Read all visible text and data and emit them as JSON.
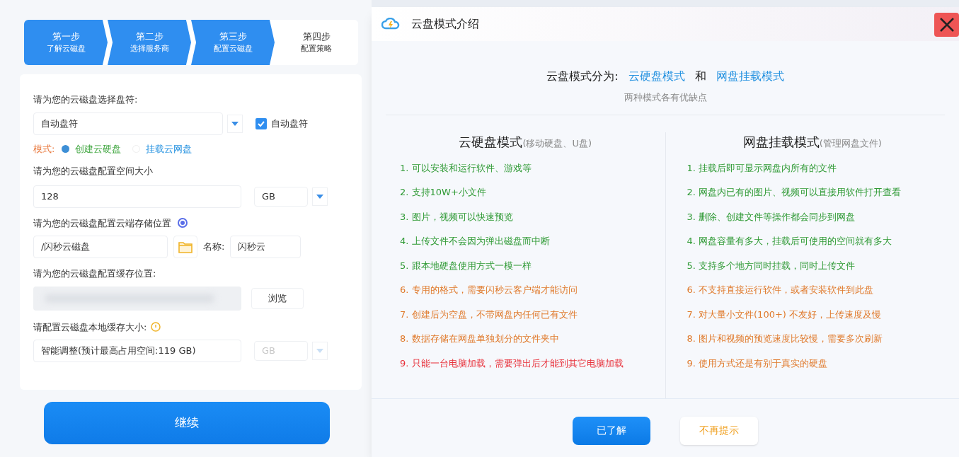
{
  "steps": [
    {
      "title": "第一步",
      "sub": "了解云磁盘",
      "completed": true
    },
    {
      "title": "第二步",
      "sub": "选择服务商",
      "completed": true
    },
    {
      "title": "第三步",
      "sub": "配置云磁盘",
      "completed": true
    },
    {
      "title": "第四步",
      "sub": "配置策略",
      "completed": false
    }
  ],
  "form": {
    "drive_letter": {
      "label": "请为您的云磁盘选择盘符:",
      "value": "自动盘符",
      "checkbox": {
        "label": "自动盘符",
        "checked": true
      }
    },
    "mode": {
      "label": "模式:",
      "options": [
        {
          "label": "创建云硬盘",
          "selected": true
        },
        {
          "label": "挂载云网盘",
          "selected": false
        }
      ]
    },
    "size": {
      "label": "请为您的云磁盘配置空间大小",
      "value": "128",
      "unit": "GB",
      "disabled": false
    },
    "cloud_location": {
      "label": "请为您的云磁盘配置云端存储位置",
      "value": "/闪秒云磁盘",
      "name_label": "名称:",
      "name_value": "闪秒云"
    },
    "cache_location": {
      "label": "请为您的云磁盘配置缓存位置:",
      "browse": "浏览"
    },
    "cache_size": {
      "label": "请配置云磁盘本地缓存大小:",
      "value": "智能调整(预计最高占用空间:119 GB)",
      "unit": "GB",
      "disabled": true
    },
    "continue": "继续"
  },
  "dialog": {
    "title": "云盘模式介绍",
    "intro": {
      "prefix": "云盘模式分为:",
      "mode_a": "云硬盘模式",
      "conj": "和",
      "mode_b": "网盘挂载模式",
      "subtitle": "两种模式各有优缺点"
    },
    "columns": [
      {
        "title": "云硬盘模式",
        "note": "(移动硬盘、U盘)",
        "items": [
          {
            "text": "1. 可以安装和运行软件、游戏等",
            "color": "#2f9a35"
          },
          {
            "text": "2. 支持10W+小文件",
            "color": "#2f9a35"
          },
          {
            "text": "3. 图片，视频可以快速预览",
            "color": "#2f9a35"
          },
          {
            "text": "4. 上传文件不会因为弹出磁盘而中断",
            "color": "#2f9a35"
          },
          {
            "text": "5. 跟本地硬盘使用方式一模一样",
            "color": "#2f9a35"
          },
          {
            "text": "6. 专用的格式，需要闪秒云客户端才能访问",
            "color": "#e07a2c"
          },
          {
            "text": "7. 创建后为空盘，不带网盘内任何已有文件",
            "color": "#e07a2c"
          },
          {
            "text": "8. 数据存储在网盘单独划分的文件夹中",
            "color": "#e07a2c"
          },
          {
            "text": "9. 只能一台电脑加载，需要弹出后才能到其它电脑加载",
            "color": "#e8303a"
          }
        ]
      },
      {
        "title": "网盘挂载模式",
        "note": "(管理网盘文件)",
        "items": [
          {
            "text": "1. 挂载后即可显示网盘内所有的文件",
            "color": "#2f9a35"
          },
          {
            "text": "2. 网盘内已有的图片、视频可以直接用软件打开查看",
            "color": "#2f9a35"
          },
          {
            "text": "3. 删除、创建文件等操作都会同步到网盘",
            "color": "#2f9a35"
          },
          {
            "text": "4. 网盘容量有多大，挂载后可使用的空间就有多大",
            "color": "#2f9a35"
          },
          {
            "text": "5. 支持多个地方同时挂载，同时上传文件",
            "color": "#2f9a35"
          },
          {
            "text": "6. 不支持直接运行软件，或者安装软件到此盘",
            "color": "#e07a2c"
          },
          {
            "text": "7. 对大量小文件(100+) 不友好，上传速度及慢",
            "color": "#e07a2c"
          },
          {
            "text": "8. 图片和视频的预览速度比较慢，需要多次刷新",
            "color": "#e07a2c"
          },
          {
            "text": "9. 使用方式还是有别于真实的硬盘",
            "color": "#e07a2c"
          }
        ]
      }
    ],
    "buttons": [
      {
        "label": "已了解",
        "kind": "primary"
      },
      {
        "label": "不再提示",
        "kind": "secondary"
      }
    ]
  }
}
